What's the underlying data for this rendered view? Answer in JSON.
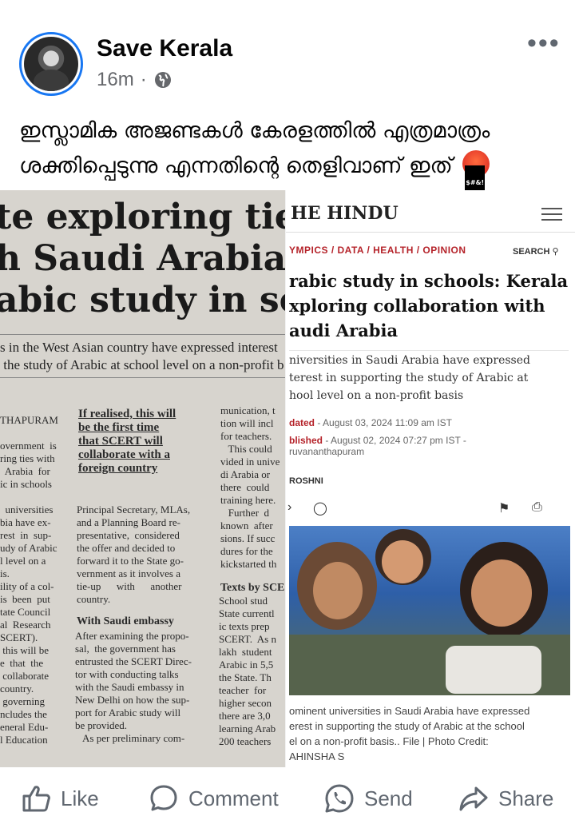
{
  "post": {
    "author": "Save Kerala",
    "time": "16m",
    "separator": "·",
    "text": "ഇസ്ലാമിക അജണ്ടകൾ കേരളത്തിൽ എത്രമാത്രം ശക്തിപ്പെടുന്നു എന്നതിന്റെ തെളിവാണ് ഇത്"
  },
  "newspaper": {
    "headline": "te exploring tie-u\nh Saudi Arabia fo\nabic study in scho",
    "sub": "s in the West Asian country have expressed interest\n the study of Arabic at school level on a non-profit b",
    "col1": "THAPURAM\n\novernment  is\nring ties with\n  Arabia  for\nic in schools\n\n  universities\nbia have ex-\nrest  in  sup-\nudy of Arabic\nl level on a\nis.\nility of a col-\nis  been  put\ntate Council\nal  Research\nSCERT).\n this will be\ne  that  the\n collaborate\ncountry.\n governing\nncludes the\neneral Edu-\nl Education",
    "pull_quote": "If realised, this will\nbe the first time\nthat SCERT will\ncollaborate with a\nforeign country",
    "col2_body": "Principal Secretary, MLAs,\nand a Planning Board re-\npresentative,  considered\nthe offer and decided to\nforward it to the State go-\nvernment as it involves a\ntie-up      with      another\ncountry.",
    "col2_heading": "With Saudi embassy",
    "col2_body2": "After examining the propo-\nsal,  the government has\nentrusted the SCERT Direc-\ntor with conducting talks\nwith the Saudi embassy in\nNew Delhi on how the sup-\nport for Arabic study will\nbe provided.\n   As per preliminary com-",
    "col3_body": "munication, t\ntion will incl\nfor teachers.\n   This could\nvided in unive\ndi Arabia or\nthere  could\ntraining here.\n   Further  d\nknown  after\nsions. If succ\ndures for the\nkickstarted th",
    "col3_heading": "Texts by SCE",
    "col3_body2": "School stud\nState currentl\nic texts prep\nSCERT.  As n\nlakh  student\nArabic in 5,5\nthe State. Th\nteacher  for\nhigher secon\nthere are 3,0\nlearning Arab\n200 teachers"
  },
  "hindu": {
    "logo": "HE  HINDU",
    "nav": "YMPICS  /  DATA  /  HEALTH  /  OPINION",
    "search": "SEARCH",
    "title": "rabic study in schools: Kerala\nxploring collaboration with\naudi Arabia",
    "subtitle": "niversities in Saudi Arabia have expressed\nterest in supporting the study of Arabic at\nhool level on a non-profit basis",
    "updated_label": "dated",
    "updated": " - August 03, 2024 11:09 am IST",
    "published_label": "blished",
    "published": " - August 02, 2024 07:27 pm IST -\nruvananthapuram",
    "author": "ROSHNI",
    "caption": "ominent universities in Saudi Arabia have expressed\nerest in supporting the study of Arabic at the school\nel on a non-profit basis.. File | Photo Credit:\nAHINSHA S"
  },
  "actions": {
    "like": "Like",
    "comment": "Comment",
    "send": "Send",
    "share": "Share"
  },
  "icons": [
    "globe-icon",
    "more-icon",
    "angry-emoji-icon",
    "like-icon",
    "comment-icon",
    "send-icon",
    "share-icon"
  ],
  "colors": {
    "accent": "#1877f2",
    "muted": "#65676b",
    "hindu_red": "#b5232a"
  }
}
